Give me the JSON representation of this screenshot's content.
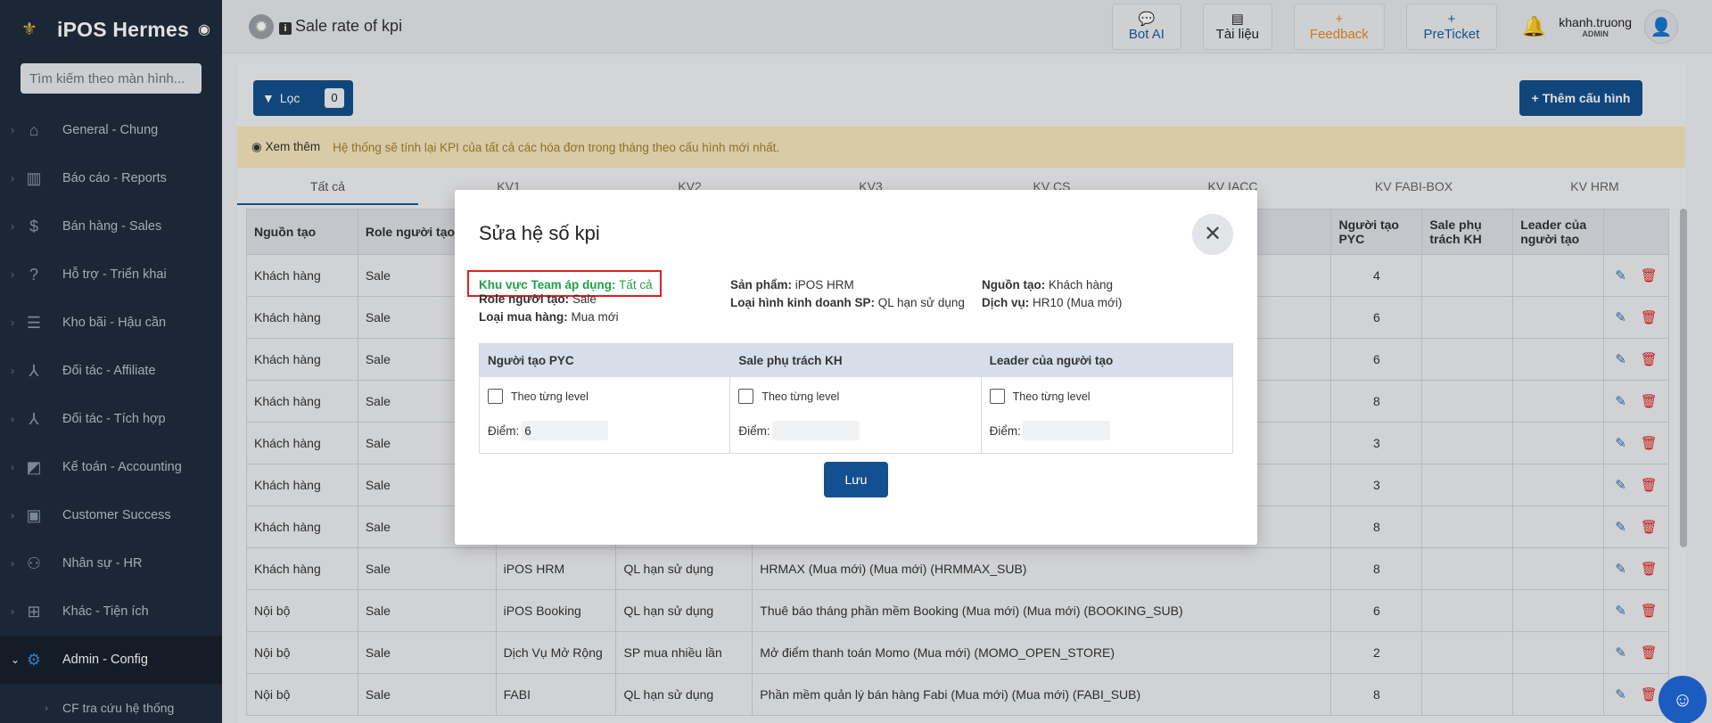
{
  "app": {
    "name": "iPOS Hermes"
  },
  "sidebar": {
    "search_placeholder": "Tìm kiếm theo màn hình...",
    "items": [
      {
        "label": "General - Chung",
        "icon": "home-icon"
      },
      {
        "label": "Báo cáo - Reports",
        "icon": "report-icon"
      },
      {
        "label": "Bán hàng - Sales",
        "icon": "dollar-icon"
      },
      {
        "label": "Hỗ trợ - Triển khai",
        "icon": "help-icon"
      },
      {
        "label": "Kho bãi - Hậu cần",
        "icon": "list-icon"
      },
      {
        "label": "Đối tác - Affiliate",
        "icon": "network-icon"
      },
      {
        "label": "Đối tác - Tích hợp",
        "icon": "network-icon"
      },
      {
        "label": "Kế toán - Accounting",
        "icon": "chart-icon"
      },
      {
        "label": "Customer Success",
        "icon": "id-card-icon"
      },
      {
        "label": "Nhân sự - HR",
        "icon": "people-icon"
      },
      {
        "label": "Khác - Tiện ích",
        "icon": "monitor-plus-icon"
      },
      {
        "label": "Admin - Config",
        "icon": "gear-icon"
      }
    ],
    "submenu": {
      "label": "CF tra cứu hệ thống"
    }
  },
  "topbar": {
    "title": "Sale rate of kpi",
    "buttons": {
      "bot": "Bot AI",
      "docs": "Tài liệu",
      "feedback": "Feedback",
      "preticket": "PreTicket"
    },
    "user": {
      "name": "khanh.truong",
      "role": "ADMIN"
    }
  },
  "main": {
    "filter_label": "Lọc",
    "filter_count": "0",
    "add_label": "Thêm cấu hình",
    "notice_link": "Xem thêm",
    "notice_text": "Hệ thống sẽ tính lại KPI của tất cả các hóa đơn trong tháng theo cấu hình mới nhất.",
    "tabs": [
      "Tất cả",
      "KV1",
      "KV2",
      "KV3",
      "KV CS",
      "KV IACC",
      "KV FABI-BOX",
      "KV HRM"
    ],
    "columns": [
      "Nguồn tạo",
      "Role người tạo",
      "",
      "",
      "",
      "Người tạo PYC",
      "Sale phụ trách KH",
      "Leader của người tạo",
      ""
    ],
    "rows": [
      [
        "Khách hàng",
        "Sale",
        "",
        "",
        "",
        "4"
      ],
      [
        "Khách hàng",
        "Sale",
        "",
        "",
        "",
        "6"
      ],
      [
        "Khách hàng",
        "Sale",
        "",
        "",
        "",
        "6"
      ],
      [
        "Khách hàng",
        "Sale",
        "",
        "",
        "",
        "8"
      ],
      [
        "Khách hàng",
        "Sale",
        "",
        "",
        "",
        "3"
      ],
      [
        "Khách hàng",
        "Sale",
        "",
        "",
        "",
        "3"
      ],
      [
        "Khách hàng",
        "Sale",
        "",
        "",
        "",
        "8"
      ],
      [
        "Khách hàng",
        "Sale",
        "iPOS HRM",
        "QL hạn sử dụng",
        "HRMAX (Mua mới) (Mua mới) (HRMMAX_SUB)",
        "8"
      ],
      [
        "Nội bộ",
        "Sale",
        "iPOS Booking",
        "QL hạn sử dụng",
        "Thuê báo tháng phần mềm Booking (Mua mới) (Mua mới) (BOOKING_SUB)",
        "6"
      ],
      [
        "Nội bộ",
        "Sale",
        "Dịch Vụ Mở Rộng",
        "SP mua nhiều lần",
        "Mở điểm thanh toán Momo (Mua mới) (MOMO_OPEN_STORE)",
        "2"
      ],
      [
        "Nội bộ",
        "Sale",
        "FABI",
        "QL hạn sử dụng",
        "Phần mềm quản lý bán hàng Fabi (Mua mới) (Mua mới) (FABI_SUB)",
        "8"
      ]
    ]
  },
  "modal": {
    "title": "Sửa hệ số kpi",
    "info": {
      "khu_vuc_label": "Khu vực Team áp dụng:",
      "khu_vuc_value": "Tất cả",
      "role_label": "Role người tạo:",
      "role_value": "Sale",
      "loai_mua_label": "Loại mua hàng:",
      "loai_mua_value": "Mua mới",
      "san_pham_label": "Sản phẩm:",
      "san_pham_value": "iPOS HRM",
      "loai_hinh_label": "Loại hình kinh doanh SP:",
      "loai_hinh_value": "QL hạn sử dụng",
      "nguon_tao_label": "Nguồn tạo:",
      "nguon_tao_value": "Khách hàng",
      "dich_vu_label": "Dịch vụ:",
      "dich_vu_value": "HR10 (Mua mới)"
    },
    "kpi_columns": [
      {
        "header": "Người tạo PYC",
        "checkbox_label": "Theo từng level",
        "score_label": "Điểm:",
        "score_value": "6"
      },
      {
        "header": "Sale phụ trách KH",
        "checkbox_label": "Theo từng level",
        "score_label": "Điểm:",
        "score_value": ""
      },
      {
        "header": "Leader của người tạo",
        "checkbox_label": "Theo từng level",
        "score_label": "Điểm:",
        "score_value": ""
      }
    ],
    "save_label": "Lưu"
  },
  "colors": {
    "primary": "#14508f",
    "sidebar": "#1f2d3d",
    "highlight": "#e02020",
    "green": "#1fa14a"
  }
}
